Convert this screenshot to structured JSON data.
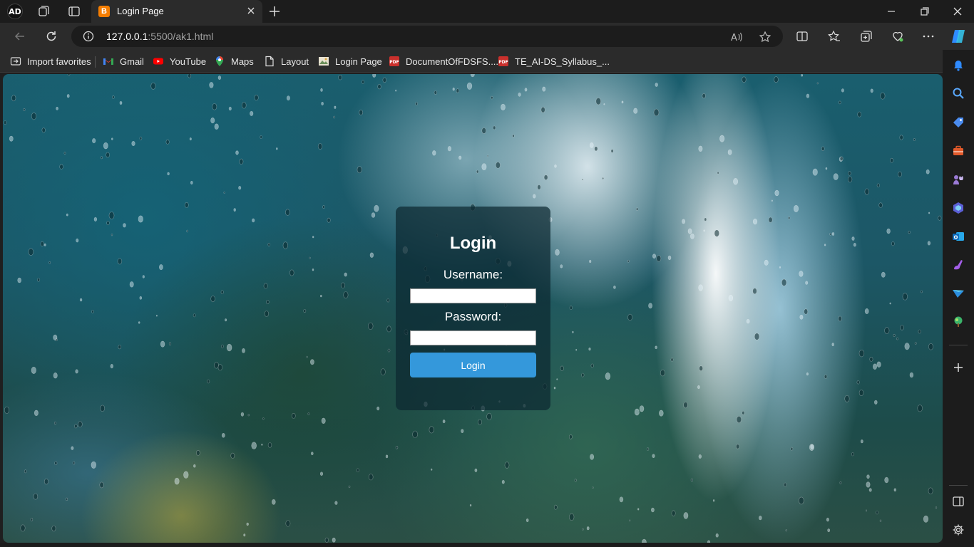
{
  "browser": {
    "profile_initials": "AD",
    "tab": {
      "title": "Login Page",
      "favicon_letter": "B"
    },
    "address": {
      "host": "127.0.0.1",
      "path": ":5500/ak1.html"
    }
  },
  "bookmarks": [
    {
      "label": "Import favorites",
      "icon": "import-favorites-icon"
    },
    {
      "label": "Gmail",
      "icon": "gmail-icon"
    },
    {
      "label": "YouTube",
      "icon": "youtube-icon"
    },
    {
      "label": "Maps",
      "icon": "maps-icon"
    },
    {
      "label": "Layout",
      "icon": "page-icon"
    },
    {
      "label": "Login Page",
      "icon": "login-page-icon"
    },
    {
      "label": "DocumentOfFDSFS....",
      "icon": "pdf-icon"
    },
    {
      "label": "TE_AI-DS_Syllabus_...",
      "icon": "pdf-icon"
    }
  ],
  "login": {
    "title": "Login",
    "username_label": "Username:",
    "password_label": "Password:",
    "username_value": "",
    "password_value": "",
    "button_label": "Login"
  },
  "colors": {
    "button": "#3498db",
    "card": "rgba(12,40,48,0.72)",
    "chrome": "#2b2b2b"
  }
}
